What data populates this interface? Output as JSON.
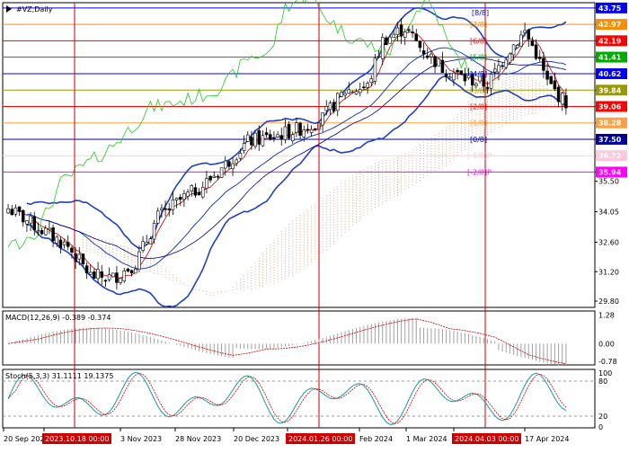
{
  "title": "#VZ,Daily",
  "main_pane": {
    "price_min": 29.5,
    "price_max": 44.0,
    "price_axis_ticks": [
      {
        "label": "43.75",
        "value": 43.75,
        "color": "#0000ff",
        "text": "#ffffff",
        "box": true
      },
      {
        "label": "42.97",
        "value": 42.97,
        "color": "#ff8c00",
        "text": "#ffffff",
        "box": true
      },
      {
        "label": "42.19",
        "value": 42.19,
        "color": "#ff0000",
        "text": "#ffffff",
        "box": true
      },
      {
        "label": "41.41",
        "value": 41.41,
        "color": "#00aa00",
        "text": "#ffffff",
        "box": true
      },
      {
        "label": "40.62",
        "value": 40.62,
        "color": "#0000ff",
        "text": "#ffffff",
        "box": true
      },
      {
        "label": "39.84",
        "value": 39.84,
        "color": "#9a9a00",
        "text": "#ffffff",
        "box": true
      },
      {
        "label": "39.06",
        "value": 39.06,
        "color": "#ff0000",
        "text": "#ffffff",
        "box": true
      },
      {
        "label": "38.28",
        "value": 38.28,
        "color": "#ffa040",
        "text": "#ffffff",
        "box": true
      },
      {
        "label": "37.50",
        "value": 37.5,
        "color": "#0000a0",
        "text": "#ffffff",
        "box": true
      },
      {
        "label": "36.72",
        "value": 36.72,
        "color": "#ffc8dc",
        "text": "#ffffff",
        "box": true
      },
      {
        "label": "35.94",
        "value": 35.94,
        "color": "#ff00ff",
        "text": "#ffffff",
        "box": true
      },
      {
        "label": "35.50",
        "value": 35.5,
        "box": false
      },
      {
        "label": "34.05",
        "value": 34.05,
        "box": false
      },
      {
        "label": "32.60",
        "value": 32.6,
        "box": false
      },
      {
        "label": "31.20",
        "value": 31.2,
        "box": false
      },
      {
        "label": "29.80",
        "value": 29.8,
        "box": false
      }
    ],
    "murrey_levels": [
      {
        "label": "[8/8]",
        "value": 43.75,
        "color": "#0000ff"
      },
      {
        "label": "[7/8]",
        "value": 42.97,
        "color": "#ff8c00"
      },
      {
        "label": "[6/8]",
        "value": 42.19,
        "color": "#ff0000"
      },
      {
        "label": "[5/8]",
        "value": 41.41,
        "color": "#00aa00"
      },
      {
        "label": "[4/8]",
        "value": 40.62,
        "color": "#0000ff"
      },
      {
        "label": "[3/8]",
        "value": 39.84,
        "color": "#9a9a00"
      },
      {
        "label": "[2/8]",
        "value": 39.06,
        "color": "#ff0000"
      },
      {
        "label": "[1/8]",
        "value": 38.28,
        "color": "#ffa040"
      },
      {
        "label": "[0/8]",
        "value": 37.5,
        "color": "#0000a0"
      },
      {
        "label": "[-1/8]P",
        "value": 36.72,
        "color": "#ffc8dc"
      },
      {
        "label": "[-2/8]P",
        "value": 35.94,
        "color": "#ff00ff"
      }
    ],
    "current_price": "39.06"
  },
  "macd_pane": {
    "label": "MACD(12,26,9) -0.389 -0.374",
    "ticks": [
      "1.28",
      "0.00",
      "-0.78"
    ]
  },
  "stoch_pane": {
    "label": "Stoch(5,3,3) 31.1111 19.1375",
    "ticks": [
      "100",
      "80",
      "20",
      "0"
    ]
  },
  "time_axis": [
    {
      "label": "20 Sep 2023",
      "highlight": false
    },
    {
      "label": "2023.10.18 00:00",
      "highlight": true
    },
    {
      "label": "3 Nov 2023",
      "highlight": false
    },
    {
      "label": "28 Nov 2023",
      "highlight": false
    },
    {
      "label": "20 Dec 2023",
      "highlight": false
    },
    {
      "label": "2024.01.26 00:00",
      "highlight": true
    },
    {
      "label": "Feb 2024",
      "highlight": false
    },
    {
      "label": "1 Mar 2024",
      "highlight": false
    },
    {
      "label": "2024.04.03 00:00",
      "highlight": true
    },
    {
      "label": "17 Apr 2024",
      "highlight": false
    }
  ],
  "colors": {
    "background": "#ffffff",
    "candle_body": "#000000",
    "bollinger": "#2040c0",
    "fast_ma": "#cc0000",
    "slow_ma": "#000080",
    "chikou": "#22cc22",
    "cloud": "#d0a080",
    "macd_hist": "#a0a0a0",
    "macd_signal": "#cc0000",
    "stoch_main": "#1a9a9a",
    "stoch_signal": "#cc0000",
    "vline": "#cc0000"
  }
}
